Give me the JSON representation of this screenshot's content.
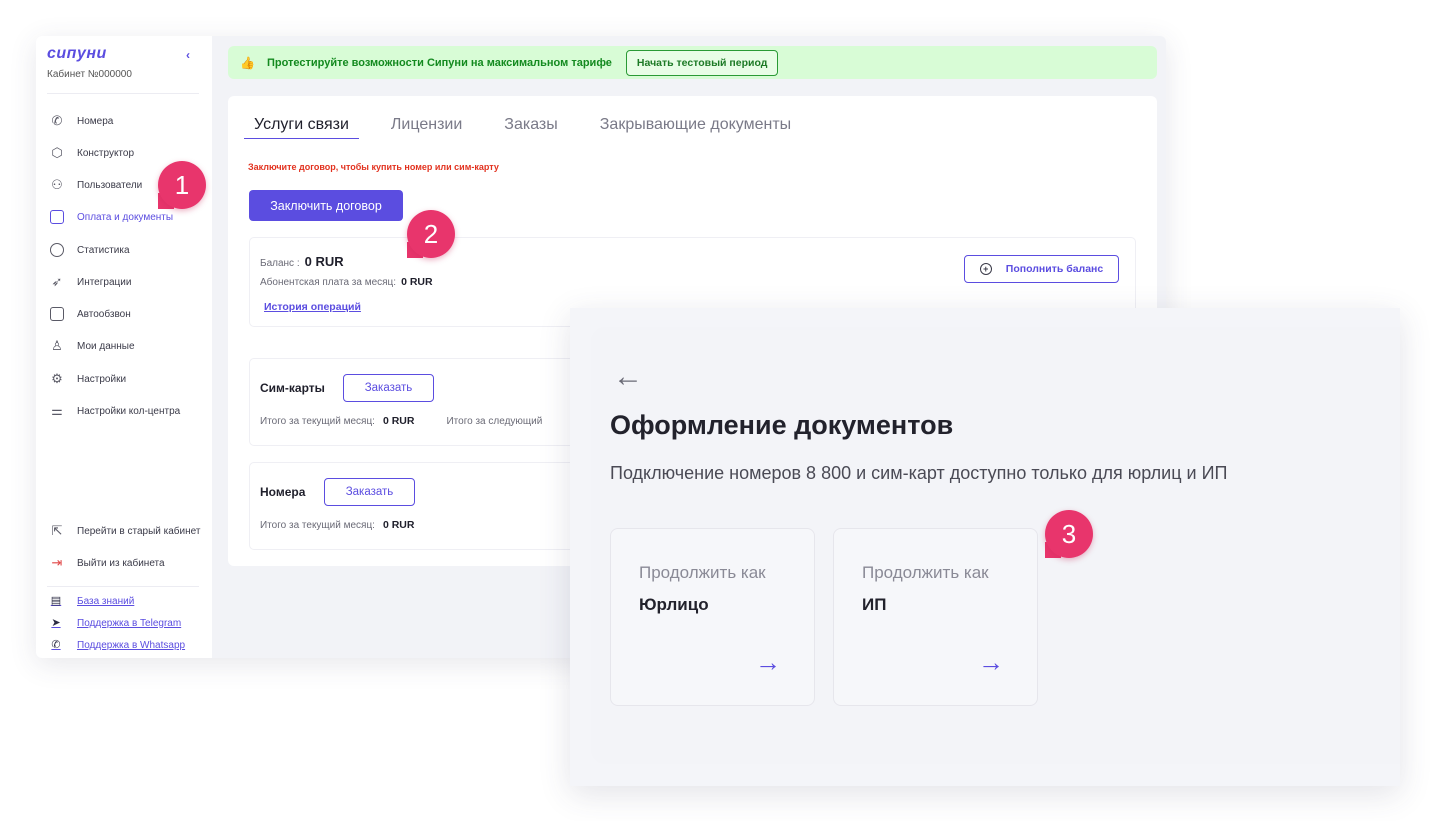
{
  "sidebar": {
    "logo": "сипуни",
    "cabinet": "Кабинет №000000",
    "nav": [
      {
        "label": "Номера",
        "icon": "phone-icon"
      },
      {
        "label": "Конструктор",
        "icon": "cube-icon"
      },
      {
        "label": "Пользователи",
        "icon": "users-icon"
      },
      {
        "label": "Оплата и документы",
        "icon": "bag-icon"
      },
      {
        "label": "Статистика",
        "icon": "pie-chart-icon"
      },
      {
        "label": "Интеграции",
        "icon": "rocket-icon"
      },
      {
        "label": "Автообзвон",
        "icon": "robot-icon"
      },
      {
        "label": "Мои данные",
        "icon": "user-icon"
      },
      {
        "label": "Настройки",
        "icon": "gear-icon"
      },
      {
        "label": "Настройки кол-центра",
        "icon": "sliders-icon"
      }
    ],
    "bottom": [
      {
        "label": "Перейти в старый кабинет",
        "icon": "external-link-icon"
      },
      {
        "label": "Выйти из кабинета",
        "icon": "logout-icon"
      }
    ],
    "links": [
      {
        "label": "База знаний",
        "icon": "clipboard-icon"
      },
      {
        "label": "Поддержка в Telegram",
        "icon": "telegram-icon"
      },
      {
        "label": "Поддержка в Whatsapp",
        "icon": "whatsapp-icon"
      }
    ]
  },
  "banner": {
    "text": "Протестируйте возможности Сипуни на максимальном тарифе",
    "button": "Начать тестовый период"
  },
  "tabs": [
    "Услуги связи",
    "Лицензии",
    "Заказы",
    "Закрывающие документы"
  ],
  "warning": "Заключите договор, чтобы купить номер или сим-карту",
  "contract_button": "Заключить договор",
  "balance": {
    "label": "Баланс :",
    "value": "0 RUR",
    "fee_label": "Абонентская плата за месяц:",
    "fee_value": "0 RUR",
    "history": "История операций",
    "topup": "Пополнить баланс"
  },
  "sim": {
    "title": "Сим-карты",
    "order": "Заказать",
    "current_label": "Итого за текущий месяц:",
    "current_value": "0 RUR",
    "next_label": "Итого за следующий"
  },
  "numbers": {
    "title": "Номера",
    "order": "Заказать",
    "current_label": "Итого за текущий месяц:",
    "current_value": "0 RUR"
  },
  "modal": {
    "title": "Оформление документов",
    "subtitle": "Подключение номеров 8 800 и сим-карт доступно только для юрлиц и ИП",
    "choices": [
      {
        "line1": "Продолжить как",
        "line2": "Юрлицо"
      },
      {
        "line1": "Продолжить как",
        "line2": "ИП"
      }
    ]
  },
  "badges": [
    "1",
    "2",
    "3"
  ],
  "colors": {
    "accent": "#5b4de0",
    "badge": "#e8356c",
    "banner_bg": "#d8fcd6",
    "warning": "#e2321f"
  }
}
